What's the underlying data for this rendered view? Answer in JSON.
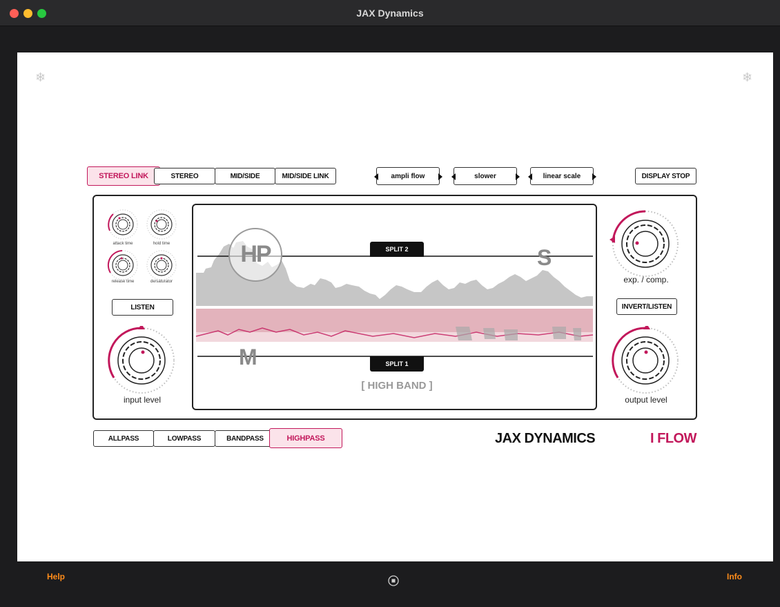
{
  "window": {
    "title": "JAX Dynamics"
  },
  "colors": {
    "accent": "#c2185b",
    "accent_light": "#fbe3ea",
    "footer_link": "#ff8c1a"
  },
  "top_buttons": {
    "stereo_link": "STEREO LINK",
    "stereo": "STEREO",
    "mid_side": "MID/SIDE",
    "mid_side_link": "MID/SIDE LINK",
    "display_stop": "DISPLAY STOP"
  },
  "selectors": {
    "mode": "ampli flow",
    "speed": "slower",
    "scale": "linear scale"
  },
  "left_controls": {
    "attack_time": "attack time",
    "hold_time": "hold time",
    "release_time": "release time",
    "desaturator": "de/saturator",
    "listen": "LISTEN",
    "input_level": "input level"
  },
  "right_controls": {
    "exp_comp": "exp. / comp.",
    "invert_listen": "INVERT/LISTEN",
    "output_level": "output level"
  },
  "display": {
    "filter_badge": "HP",
    "split2": "SPLIT 2",
    "split1": "SPLIT 1",
    "side_label": "S",
    "mid_label": "M",
    "band_label": "[ HIGH BAND ]"
  },
  "filter_buttons": {
    "allpass": "ALLPASS",
    "lowpass": "LOWPASS",
    "bandpass": "BANDPASS",
    "highpass": "HIGHPASS"
  },
  "branding": {
    "name": "JAX DYNAMICS",
    "product": "I FLOW"
  },
  "footer": {
    "help": "Help",
    "info": "Info"
  }
}
